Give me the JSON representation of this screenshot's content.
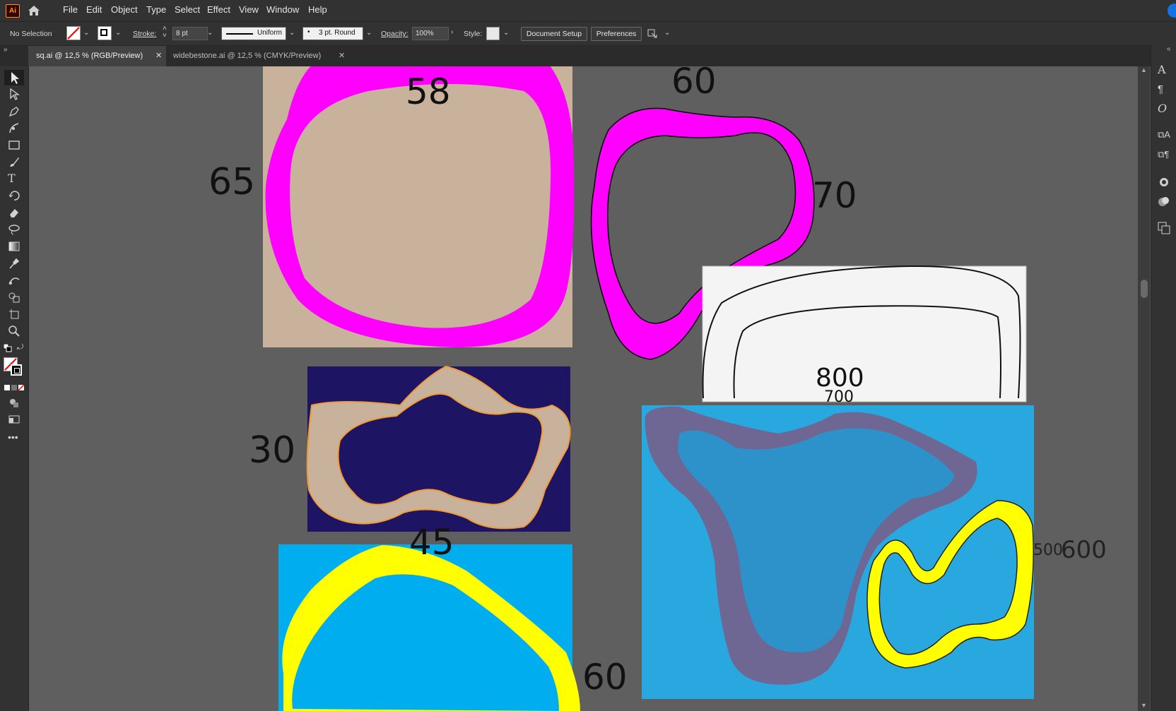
{
  "app": {
    "logo": "Ai"
  },
  "menu": [
    "File",
    "Edit",
    "Object",
    "Type",
    "Select",
    "Effect",
    "View",
    "Window",
    "Help"
  ],
  "control": {
    "selection": "No Selection",
    "stroke_label": "Stroke:",
    "stroke_value": "8 pt",
    "profile": "Uniform",
    "brush": "3 pt. Round",
    "opacity_label": "Opacity:",
    "opacity_value": "100%",
    "style_label": "Style:",
    "document_setup": "Document Setup",
    "preferences": "Preferences"
  },
  "tabs": [
    {
      "label": "sq.ai @ 12,5 % (RGB/Preview)",
      "active": true
    },
    {
      "label": "widebestone.ai @ 12,5 % (CMYK/Preview)",
      "active": false
    }
  ],
  "canvas_labels": {
    "l58": "58",
    "l65": "65",
    "l60top": "60",
    "l70": "70",
    "l800": "800",
    "l700": "700",
    "l30": "30",
    "l45": "45",
    "l500": "500",
    "l600": "600",
    "l60bottom": "60"
  },
  "tools": [
    "selection-tool",
    "direct-selection-tool",
    "pen-tool",
    "curvature-tool",
    "rectangle-tool",
    "paintbrush-tool",
    "type-tool",
    "rotate-tool",
    "eraser-tool",
    "lasso-tool",
    "gradient-tool",
    "eyedropper-tool",
    "blend-tool",
    "shape-builder-tool",
    "artboard-tool",
    "zoom-tool"
  ],
  "colors": {
    "magenta": "#ff00ff",
    "tan": "#c8b29b",
    "navy": "#1e1464",
    "blue": "#00aeef",
    "yellow": "#ffff00",
    "sky": "#29a8e0",
    "purple": "#7a5c86"
  }
}
